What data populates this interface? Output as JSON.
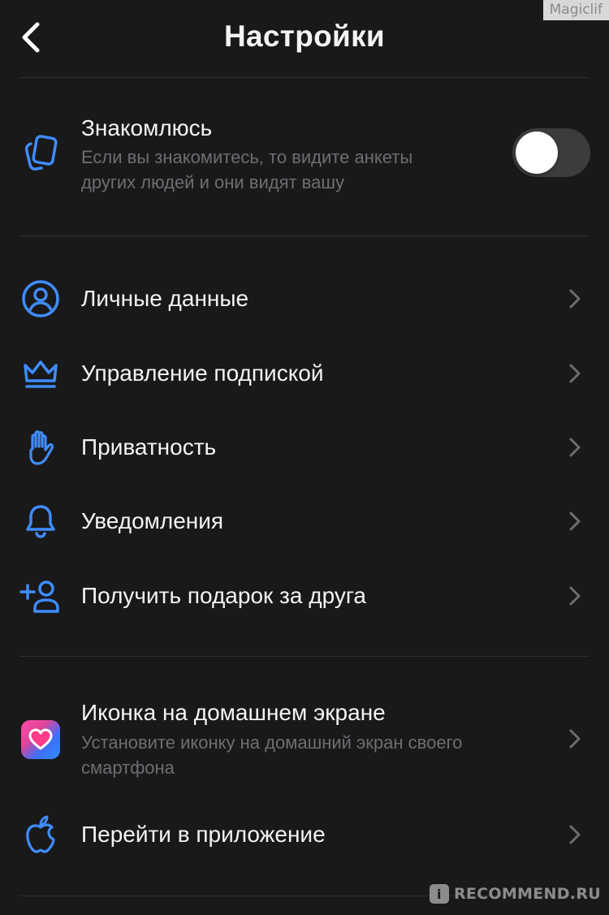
{
  "header": {
    "title": "Настройки",
    "back_icon": "chevron-left-icon"
  },
  "watermark": "Magiclif",
  "dating": {
    "title": "Знакомлюсь",
    "subtitle_line1": "Если вы знакомитесь, то видите анкеты",
    "subtitle_line2": "других людей и они видят вашу",
    "icon": "cards-icon",
    "toggle_on": false
  },
  "menu": [
    {
      "label": "Личные данные",
      "icon": "user-circle-icon"
    },
    {
      "label": "Управление подпиской",
      "icon": "crown-icon"
    },
    {
      "label": "Приватность",
      "icon": "hand-icon"
    },
    {
      "label": "Уведомления",
      "icon": "bell-icon"
    },
    {
      "label": "Получить подарок за друга",
      "icon": "user-add-icon"
    }
  ],
  "home_icon": {
    "title": "Иконка на домашнем экране",
    "subtitle_line1": "Установите иконку на домашний экран своего",
    "subtitle_line2": "смартфона",
    "icon": "app-heart-icon"
  },
  "open_app": {
    "label": "Перейти в приложение",
    "icon": "apple-icon"
  },
  "footer_watermark": {
    "badge": "i",
    "text": "RECOMMEND.RU"
  },
  "colors": {
    "background": "#19191a",
    "accent": "#3f8cff",
    "text": "#f4f4f6",
    "secondary_text": "#6d6e73"
  }
}
